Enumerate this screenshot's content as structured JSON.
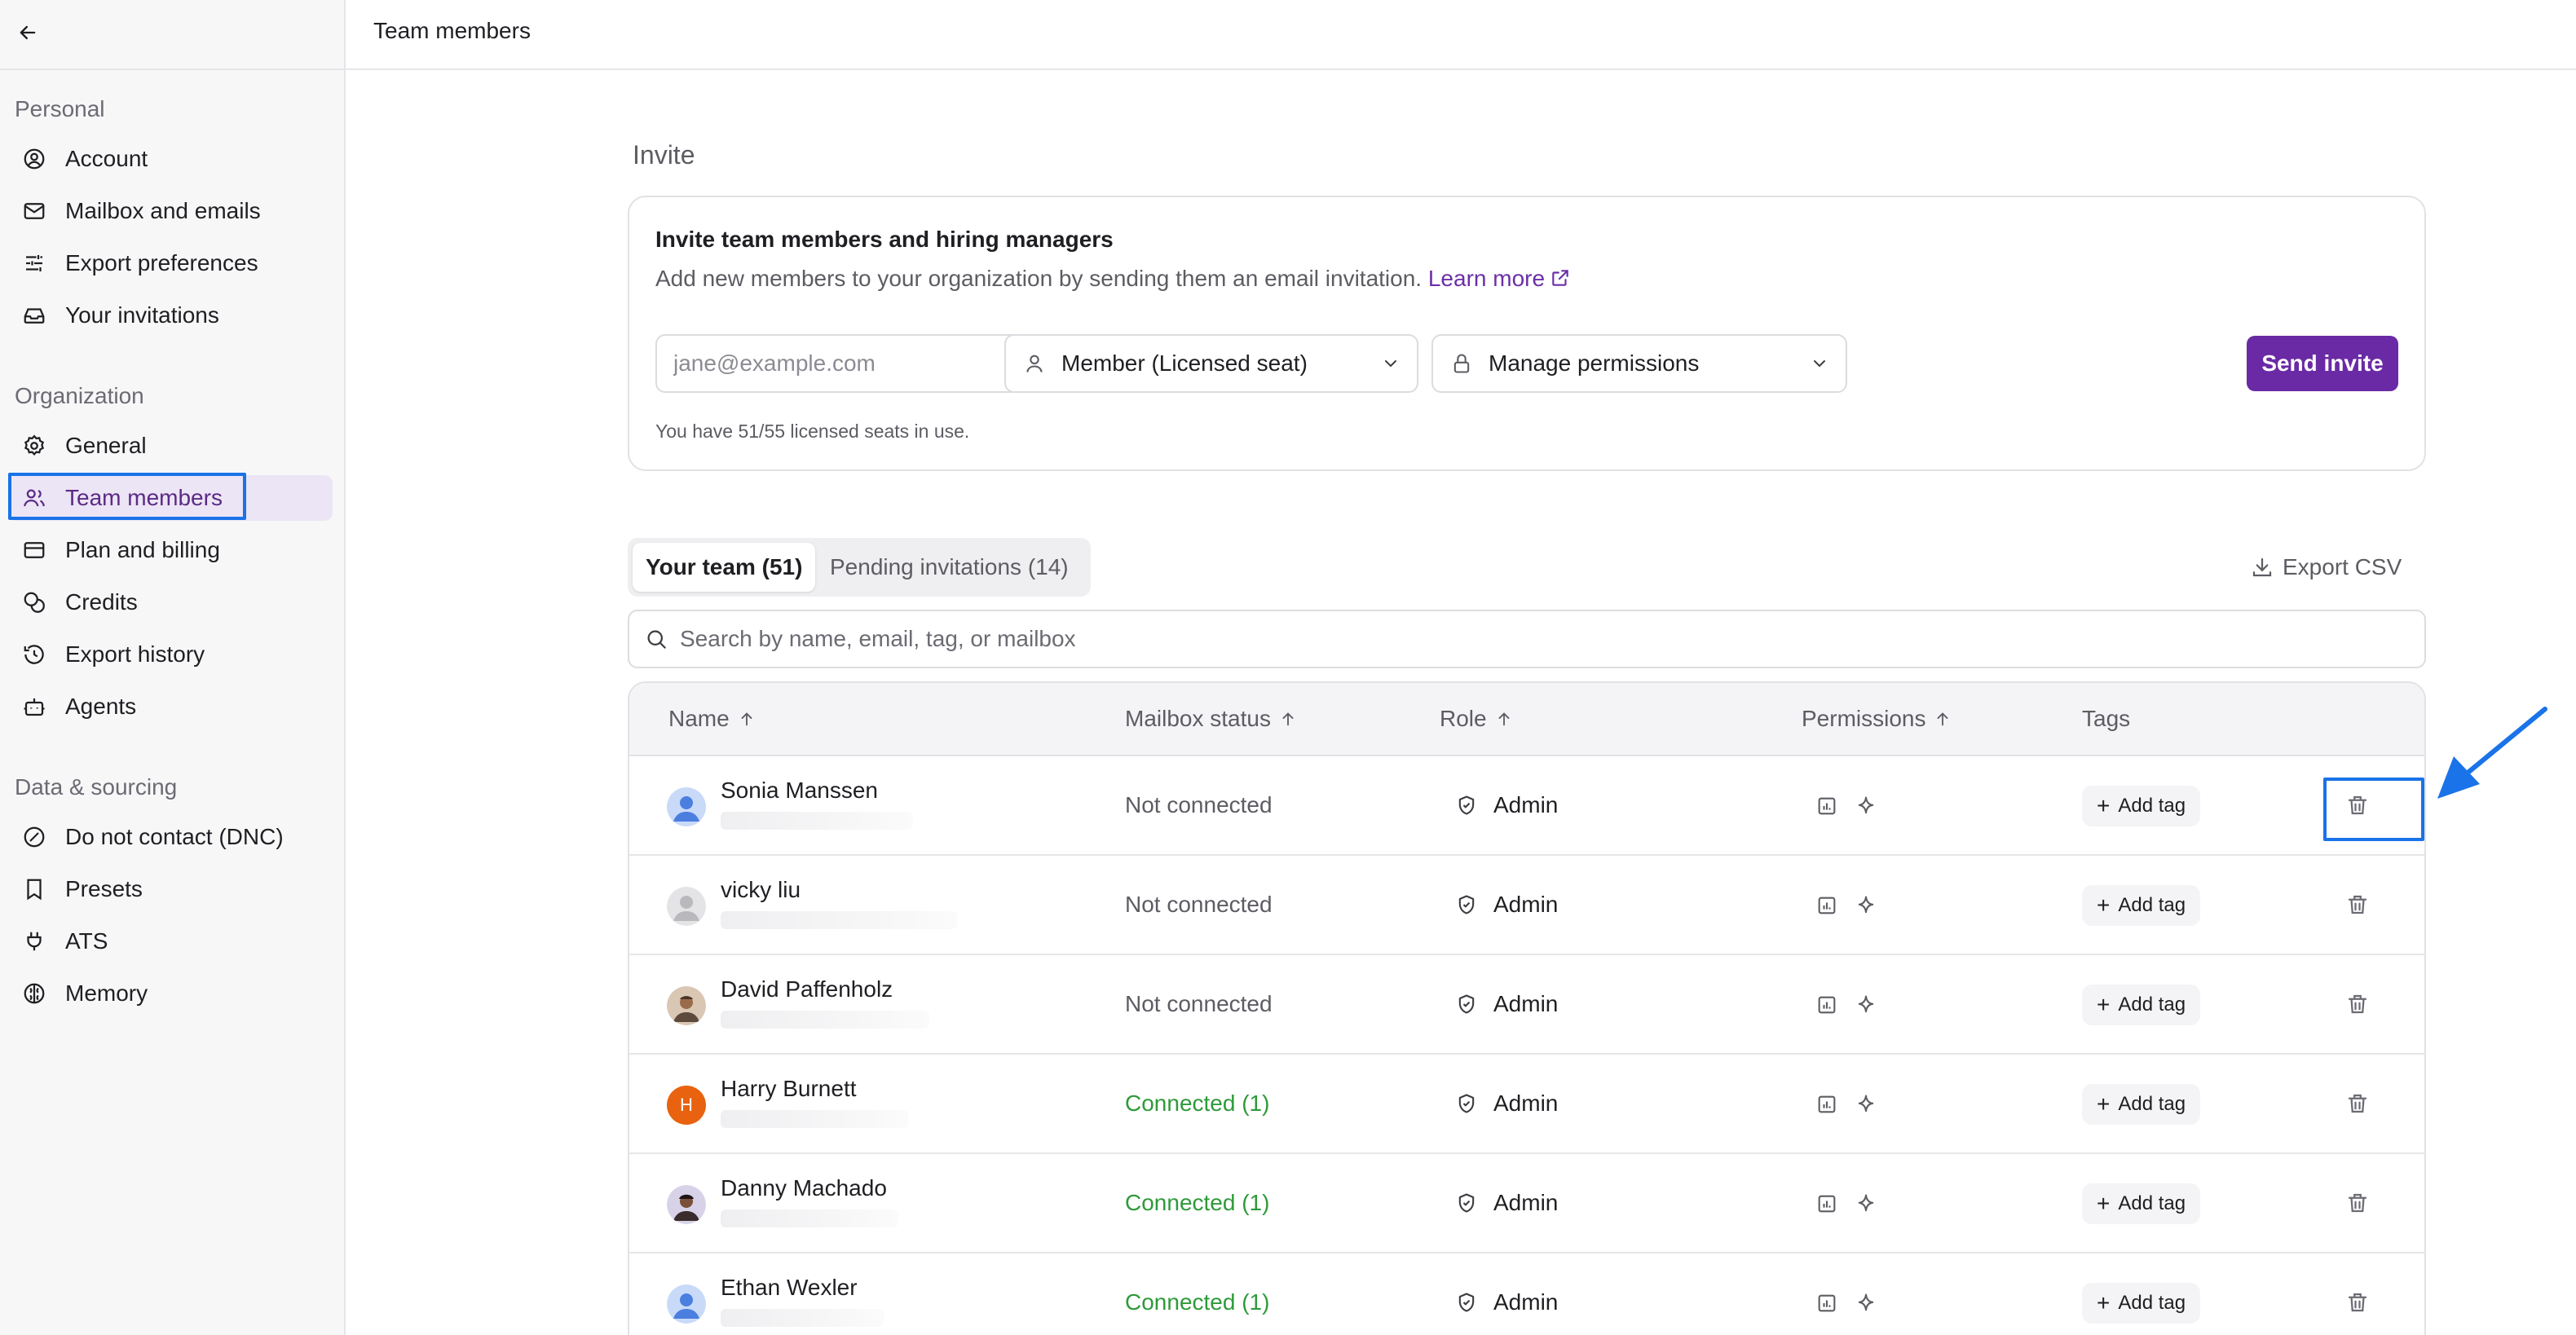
{
  "topbar": {
    "title": "Team members"
  },
  "sidebar": {
    "sections": [
      {
        "label": "Personal"
      },
      {
        "label": "Organization"
      },
      {
        "label": "Data & sourcing"
      }
    ],
    "items": [
      {
        "label": "Account",
        "icon": "user-circle-icon"
      },
      {
        "label": "Mailbox and emails",
        "icon": "mail-icon"
      },
      {
        "label": "Export preferences",
        "icon": "sliders-icon"
      },
      {
        "label": "Your invitations",
        "icon": "inbox-icon"
      },
      {
        "label": "General",
        "icon": "gear-icon"
      },
      {
        "label": "Team members",
        "icon": "users-icon",
        "active": true
      },
      {
        "label": "Plan and billing",
        "icon": "credit-card-icon"
      },
      {
        "label": "Credits",
        "icon": "coins-icon"
      },
      {
        "label": "Export history",
        "icon": "history-icon"
      },
      {
        "label": "Agents",
        "icon": "bot-icon"
      },
      {
        "label": "Do not contact (DNC)",
        "icon": "prohibited-icon"
      },
      {
        "label": "Presets",
        "icon": "bookmark-icon"
      },
      {
        "label": "ATS",
        "icon": "plug-icon"
      },
      {
        "label": "Memory",
        "icon": "brain-icon"
      }
    ]
  },
  "invite": {
    "heading": "Invite",
    "card_title": "Invite team members and hiring managers",
    "description": "Add new members to your organization by sending them an email invitation.",
    "learn_more": "Learn more",
    "email_placeholder": "jane@example.com",
    "role_select": "Member (Licensed seat)",
    "permissions_select": "Manage permissions",
    "send_button": "Send invite",
    "seats_note": "You have 51/55 licensed seats in use."
  },
  "tabs": [
    {
      "label": "Your team (51)",
      "active": true
    },
    {
      "label": "Pending invitations (14)",
      "active": false
    }
  ],
  "export_button": "Export CSV",
  "search": {
    "placeholder": "Search by name, email, tag, or mailbox"
  },
  "table": {
    "columns": [
      "Name",
      "Mailbox status",
      "Role",
      "Permissions",
      "Tags"
    ],
    "add_tag_label": "Add tag",
    "rows": [
      {
        "name": "Sonia Manssen",
        "status": "Not connected",
        "role": "Admin"
      },
      {
        "name": "vicky liu",
        "status": "Not connected",
        "role": "Admin"
      },
      {
        "name": "David Paffenholz",
        "status": "Not connected",
        "role": "Admin"
      },
      {
        "name": "Harry Burnett",
        "status": "Connected (1)",
        "role": "Admin",
        "avatar_initial": "H"
      },
      {
        "name": "Danny Machado",
        "status": "Connected (1)",
        "role": "Admin"
      },
      {
        "name": "Ethan Wexler",
        "status": "Connected (1)",
        "role": "Admin"
      }
    ]
  },
  "colors": {
    "accent": "#6a2aa5",
    "connected": "#2e9a3a",
    "not_connected": "#5c5c63",
    "highlight": "#1a73e8"
  }
}
